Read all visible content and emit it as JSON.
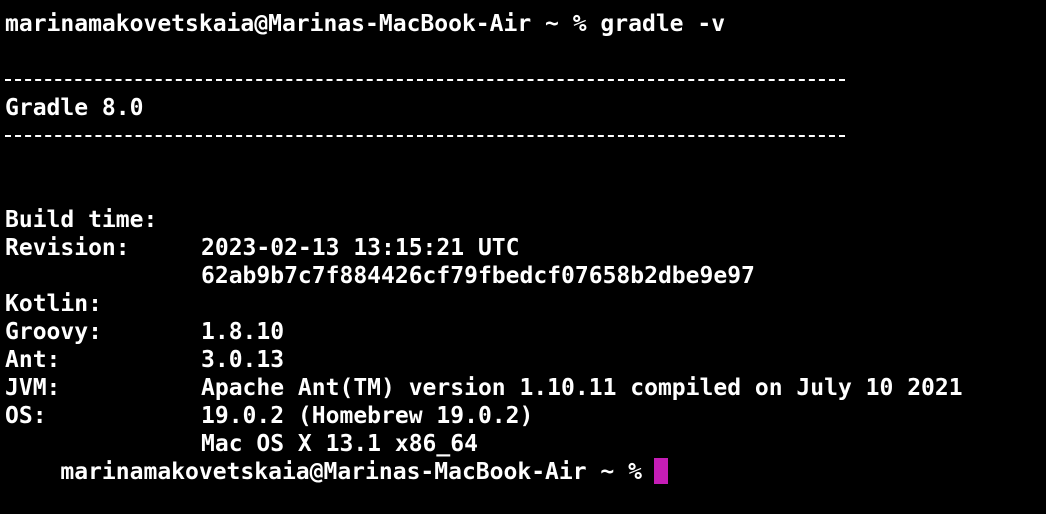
{
  "terminal": {
    "command_line": "marinamakovetskaia@Marinas-MacBook-Air ~ % gradle -v",
    "gradle_title": "Gradle 8.0",
    "info_group_1": [
      {
        "key": "Build time:",
        "value": "2023-02-13 13:15:21 UTC"
      },
      {
        "key": "Revision:",
        "value": "62ab9b7c7f884426cf79fbedcf07658b2dbe9e97"
      }
    ],
    "info_group_2": [
      {
        "key": "Kotlin:",
        "value": "1.8.10"
      },
      {
        "key": "Groovy:",
        "value": "3.0.13"
      },
      {
        "key": "Ant:",
        "value": "Apache Ant(TM) version 1.10.11 compiled on July 10 2021"
      },
      {
        "key": "JVM:",
        "value": "19.0.2 (Homebrew 19.0.2)"
      },
      {
        "key": "OS:",
        "value": "Mac OS X 13.1 x86_64"
      }
    ],
    "prompt": "marinamakovetskaia@Marinas-MacBook-Air ~ %",
    "cursor_color": "#c51db6",
    "background_color": "#000000",
    "text_color": "#ffffff"
  }
}
